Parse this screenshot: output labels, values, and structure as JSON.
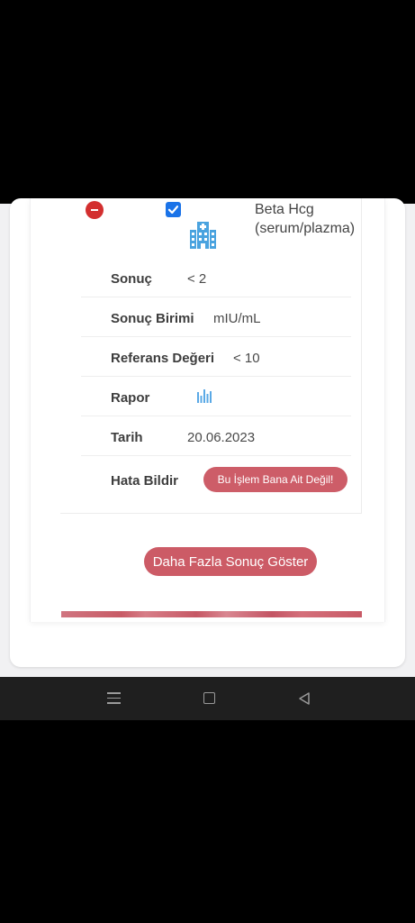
{
  "result": {
    "test_name": "Beta Hcg (serum/plazma)",
    "fields": [
      {
        "label": "Sonuç",
        "value": "< 2"
      },
      {
        "label": "Sonuç Birimi",
        "value": "mIU/mL"
      },
      {
        "label": "Referans Değeri",
        "value": "< 10"
      },
      {
        "label": "Rapor",
        "value": ""
      },
      {
        "label": "Tarih",
        "value": "20.06.2023"
      },
      {
        "label": "Hata Bildir",
        "value": ""
      }
    ],
    "error_button_label": "Bu İşlem Bana Ait Değil!",
    "checkbox_checked": true
  },
  "more_results_label": "Daha Fazla Sonuç Göster",
  "icons": {
    "remove": "minus-circle-icon",
    "checkbox": "checkbox-checked-icon",
    "hospital": "hospital-icon",
    "report": "bar-chart-icon",
    "nav_menu": "menu-icon",
    "nav_home": "home-square-icon",
    "nav_back": "back-triangle-icon"
  },
  "colors": {
    "accent": "#cc5b66",
    "remove": "#d32f2f",
    "checkbox": "#1a73e8",
    "hospital_icon": "#4aa3df"
  }
}
